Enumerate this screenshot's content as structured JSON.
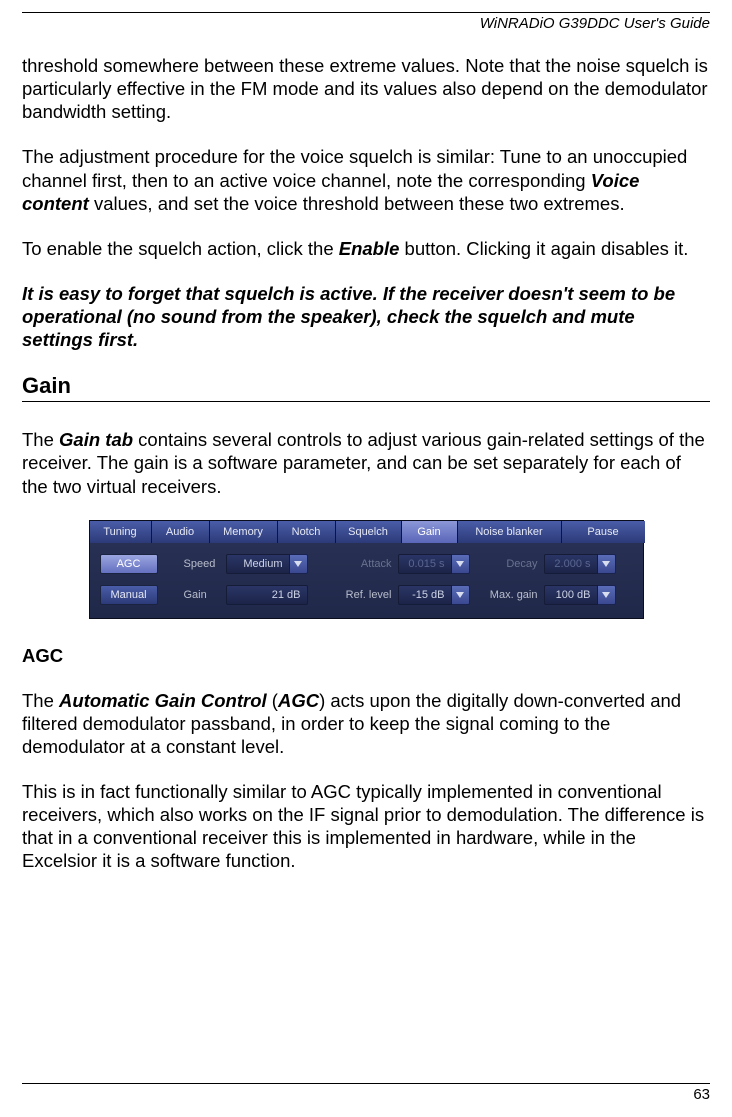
{
  "header": {
    "title": "WiNRADiO G39DDC User's Guide"
  },
  "p1": {
    "t1": "threshold somewhere between these extreme values. Note that the noise squelch is particularly effective in the FM mode and its values also depend on the demodulator bandwidth setting."
  },
  "p2": {
    "a": "The adjustment procedure for the voice squelch is similar: Tune to an unoccupied channel first, then to an active voice channel, note the corresponding ",
    "b": "Voice content",
    "c": " values, and set the voice threshold between these two extremes."
  },
  "p3": {
    "a": "To enable the squelch action, click the ",
    "b": "Enable",
    "c": " button. Clicking it again disables it."
  },
  "p4": {
    "t": "It is easy to forget that squelch is active. If the receiver doesn't seem to be operational (no sound from the speaker), check the squelch and mute settings first."
  },
  "h_gain": "Gain",
  "p5": {
    "a": "The ",
    "b": "Gain tab",
    "c": " contains several controls to adjust various gain-related settings of the receiver. The gain is a software parameter, and can be set separately for each of the two virtual receivers."
  },
  "panel": {
    "tabs": [
      "Tuning",
      "Audio",
      "Memory",
      "Notch",
      "Squelch",
      "Gain",
      "Noise blanker",
      "Pause"
    ],
    "active_tab": "Gain",
    "modes": {
      "agc": "AGC",
      "manual": "Manual"
    },
    "labels": {
      "speed": "Speed",
      "gain": "Gain",
      "attack": "Attack",
      "reflevel": "Ref. level",
      "decay": "Decay",
      "maxgain": "Max. gain"
    },
    "values": {
      "speed": "Medium",
      "gain": "21 dB",
      "attack": "0.015 s",
      "reflevel": "-15 dB",
      "decay": "2.000 s",
      "maxgain": "100 dB"
    }
  },
  "h_agc": "AGC",
  "p6": {
    "a": "The ",
    "b": "Automatic Gain Control",
    "c": " (",
    "d": "AGC",
    "e": ") acts upon the digitally down-converted and filtered demodulator passband, in order to keep the signal coming to the demodulator at a constant level."
  },
  "p7": {
    "t": "This is in fact functionally similar to AGC typically implemented in conventional receivers, which also works on the IF signal prior to demodulation. The difference is that in a conventional receiver this is implemented in hardware, while in the Excelsior it is a software function."
  },
  "footer": {
    "page": "63"
  }
}
